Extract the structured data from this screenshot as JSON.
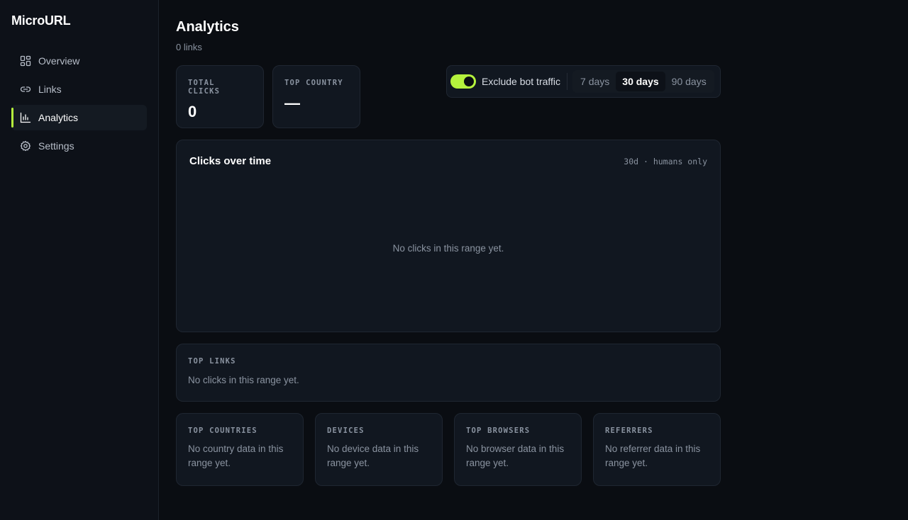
{
  "app": {
    "name": "MicroURL"
  },
  "sidebar": {
    "items": [
      {
        "label": "Overview",
        "icon": "grid-icon",
        "active": false
      },
      {
        "label": "Links",
        "icon": "link-icon",
        "active": false
      },
      {
        "label": "Analytics",
        "icon": "bar-chart-icon",
        "active": true
      },
      {
        "label": "Settings",
        "icon": "gear-icon",
        "active": false
      }
    ]
  },
  "header": {
    "title": "Analytics",
    "subtitle": "0 links"
  },
  "stats": {
    "total_clicks": {
      "label": "Total clicks",
      "value": "0"
    },
    "top_country": {
      "label": "Top country",
      "value": "—"
    }
  },
  "controls": {
    "exclude_bots": {
      "label": "Exclude bot traffic",
      "on": true
    },
    "ranges": [
      {
        "label": "7 days",
        "active": false
      },
      {
        "label": "30 days",
        "active": true
      },
      {
        "label": "90 days",
        "active": false
      }
    ]
  },
  "chart": {
    "title": "Clicks over time",
    "meta": "30d · humans only",
    "empty": "No clicks in this range yet."
  },
  "top_links": {
    "label": "Top links",
    "empty": "No clicks in this range yet."
  },
  "panels": [
    {
      "label": "Top countries",
      "empty": "No country data in this range yet."
    },
    {
      "label": "Devices",
      "empty": "No device data in this range yet."
    },
    {
      "label": "Top browsers",
      "empty": "No browser data in this range yet."
    },
    {
      "label": "Referrers",
      "empty": "No referrer data in this range yet."
    }
  ],
  "colors": {
    "accent": "#b5f23d",
    "background": "#0a0d12",
    "sidebar": "#0d1118",
    "card": "#111720",
    "border": "#1f2631",
    "muted_text": "#8a93a0"
  }
}
